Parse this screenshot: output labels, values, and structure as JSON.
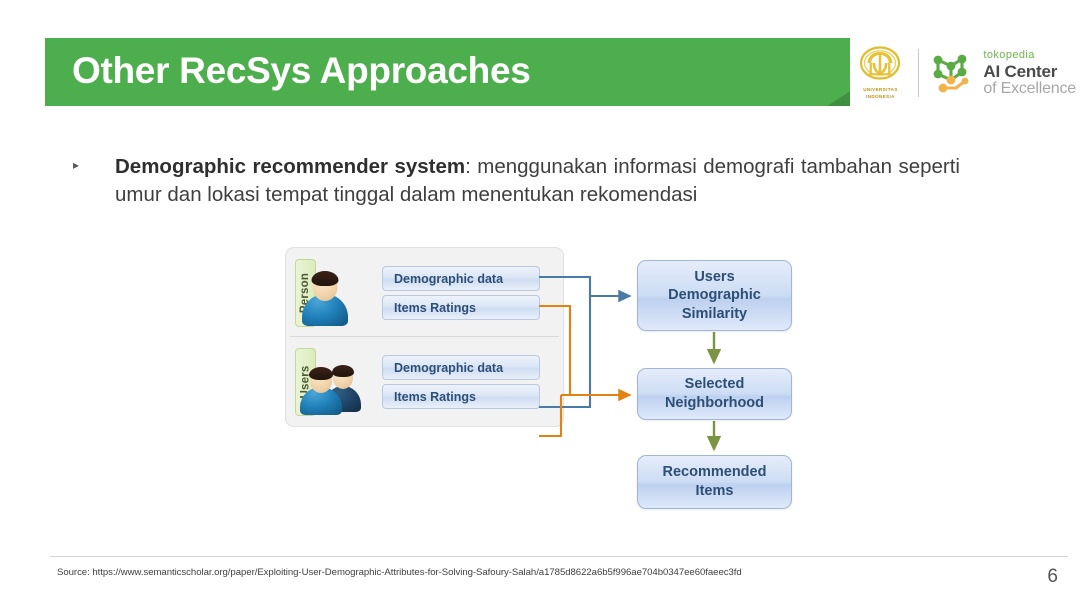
{
  "slide": {
    "title": "Other RecSys Approaches",
    "page_number": "6",
    "accent_green": "#4cae4c",
    "fold_green": "#3f9140"
  },
  "logos": {
    "university_seal": {
      "icon": "makara-seal-icon",
      "line1": "UNIVERSITAS",
      "line2": "INDONESIA",
      "color": "#e8c13a"
    },
    "ace": {
      "icon": "network-nodes-icon",
      "brand": "tokopedia",
      "line1": "AI Center",
      "line2": "of Excellence",
      "brand_color": "#69b949",
      "node_green": "#5aab45",
      "node_orange": "#f2b24c"
    }
  },
  "content": {
    "bullet_marker": "▸",
    "lead": "Demographic recommender system",
    "rest": ": menggunakan informasi demografi tambahan seperti umur dan lokasi tempat tinggal dalam menentukan rekomendasi"
  },
  "diagram": {
    "groups": [
      {
        "tag": "Person",
        "avatar": "single-person-avatar",
        "boxes": [
          "Demographic data",
          "Items Ratings"
        ]
      },
      {
        "tag": "Users",
        "avatar": "group-of-users-avatar",
        "boxes": [
          "Demographic data",
          "Items Ratings"
        ]
      }
    ],
    "flow_boxes": [
      "Users Demographic Similarity",
      "Selected Neighborhood",
      "Recommended Items"
    ],
    "flow_box_lines": [
      [
        "Users",
        "Demographic",
        "Similarity"
      ],
      [
        "Selected",
        "Neighborhood"
      ],
      [
        "Recommended",
        "Items"
      ]
    ],
    "connector_colors": {
      "demographic": "#4a7aa8",
      "ratings": "#e08214",
      "flow": "#7a9444"
    }
  },
  "footer": {
    "source": "Source: https://www.semanticscholar.org/paper/Exploiting-User-Demographic-Attributes-for-Solving-Safoury-Salah/a1785d8622a6b5f996ae704b0347ee60faeec3fd"
  }
}
